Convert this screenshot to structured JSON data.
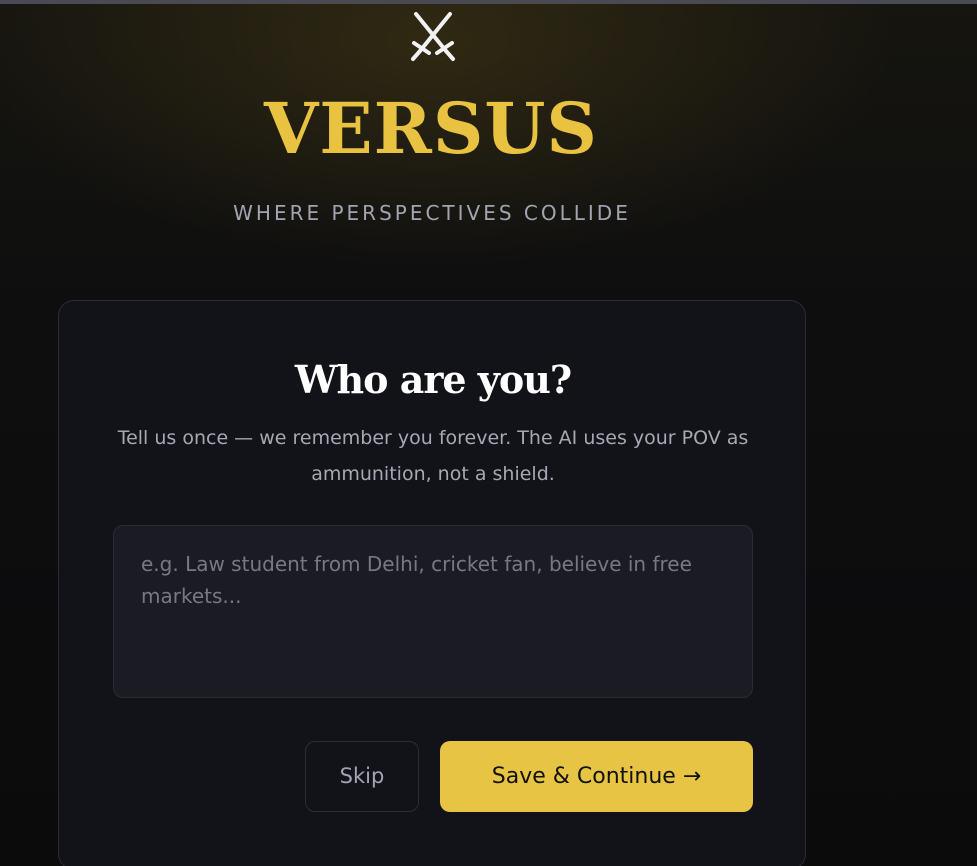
{
  "brand": {
    "logo_icon": "crossed-swords-icon",
    "title": "VERSUS",
    "tagline": "WHERE PERSPECTIVES COLLIDE"
  },
  "onboarding": {
    "heading": "Who are you?",
    "description": "Tell us once — we remember you forever. The AI uses your POV as ammunition, not a shield.",
    "pov_input": {
      "value": "",
      "placeholder": "e.g. Law student from Delhi, cricket fan, believe in free markets..."
    },
    "skip_label": "Skip",
    "save_label": "Save & Continue →"
  },
  "colors": {
    "accent": "#e8c240",
    "background": "#0c0c0e",
    "card": "#121319"
  }
}
